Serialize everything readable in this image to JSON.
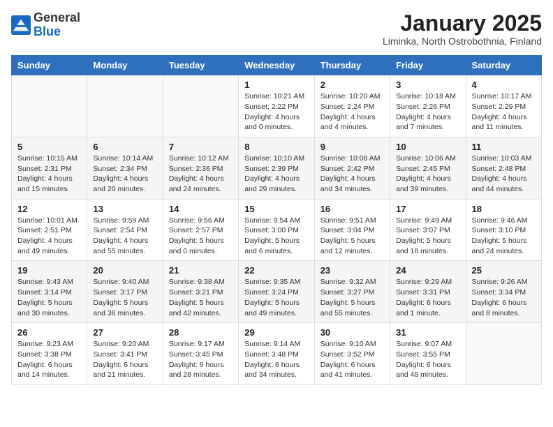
{
  "logo": {
    "general": "General",
    "blue": "Blue"
  },
  "header": {
    "month_title": "January 2025",
    "subtitle": "Liminka, North Ostrobothnia, Finland"
  },
  "days_of_week": [
    "Sunday",
    "Monday",
    "Tuesday",
    "Wednesday",
    "Thursday",
    "Friday",
    "Saturday"
  ],
  "weeks": [
    [
      {
        "day": "",
        "info": ""
      },
      {
        "day": "",
        "info": ""
      },
      {
        "day": "",
        "info": ""
      },
      {
        "day": "1",
        "info": "Sunrise: 10:21 AM\nSunset: 2:22 PM\nDaylight: 4 hours\nand 0 minutes."
      },
      {
        "day": "2",
        "info": "Sunrise: 10:20 AM\nSunset: 2:24 PM\nDaylight: 4 hours\nand 4 minutes."
      },
      {
        "day": "3",
        "info": "Sunrise: 10:18 AM\nSunset: 2:26 PM\nDaylight: 4 hours\nand 7 minutes."
      },
      {
        "day": "4",
        "info": "Sunrise: 10:17 AM\nSunset: 2:29 PM\nDaylight: 4 hours\nand 11 minutes."
      }
    ],
    [
      {
        "day": "5",
        "info": "Sunrise: 10:15 AM\nSunset: 2:31 PM\nDaylight: 4 hours\nand 15 minutes."
      },
      {
        "day": "6",
        "info": "Sunrise: 10:14 AM\nSunset: 2:34 PM\nDaylight: 4 hours\nand 20 minutes."
      },
      {
        "day": "7",
        "info": "Sunrise: 10:12 AM\nSunset: 2:36 PM\nDaylight: 4 hours\nand 24 minutes."
      },
      {
        "day": "8",
        "info": "Sunrise: 10:10 AM\nSunset: 2:39 PM\nDaylight: 4 hours\nand 29 minutes."
      },
      {
        "day": "9",
        "info": "Sunrise: 10:08 AM\nSunset: 2:42 PM\nDaylight: 4 hours\nand 34 minutes."
      },
      {
        "day": "10",
        "info": "Sunrise: 10:06 AM\nSunset: 2:45 PM\nDaylight: 4 hours\nand 39 minutes."
      },
      {
        "day": "11",
        "info": "Sunrise: 10:03 AM\nSunset: 2:48 PM\nDaylight: 4 hours\nand 44 minutes."
      }
    ],
    [
      {
        "day": "12",
        "info": "Sunrise: 10:01 AM\nSunset: 2:51 PM\nDaylight: 4 hours\nand 49 minutes."
      },
      {
        "day": "13",
        "info": "Sunrise: 9:59 AM\nSunset: 2:54 PM\nDaylight: 4 hours\nand 55 minutes."
      },
      {
        "day": "14",
        "info": "Sunrise: 9:56 AM\nSunset: 2:57 PM\nDaylight: 5 hours\nand 0 minutes."
      },
      {
        "day": "15",
        "info": "Sunrise: 9:54 AM\nSunset: 3:00 PM\nDaylight: 5 hours\nand 6 minutes."
      },
      {
        "day": "16",
        "info": "Sunrise: 9:51 AM\nSunset: 3:04 PM\nDaylight: 5 hours\nand 12 minutes."
      },
      {
        "day": "17",
        "info": "Sunrise: 9:49 AM\nSunset: 3:07 PM\nDaylight: 5 hours\nand 18 minutes."
      },
      {
        "day": "18",
        "info": "Sunrise: 9:46 AM\nSunset: 3:10 PM\nDaylight: 5 hours\nand 24 minutes."
      }
    ],
    [
      {
        "day": "19",
        "info": "Sunrise: 9:43 AM\nSunset: 3:14 PM\nDaylight: 5 hours\nand 30 minutes."
      },
      {
        "day": "20",
        "info": "Sunrise: 9:40 AM\nSunset: 3:17 PM\nDaylight: 5 hours\nand 36 minutes."
      },
      {
        "day": "21",
        "info": "Sunrise: 9:38 AM\nSunset: 3:21 PM\nDaylight: 5 hours\nand 42 minutes."
      },
      {
        "day": "22",
        "info": "Sunrise: 9:35 AM\nSunset: 3:24 PM\nDaylight: 5 hours\nand 49 minutes."
      },
      {
        "day": "23",
        "info": "Sunrise: 9:32 AM\nSunset: 3:27 PM\nDaylight: 5 hours\nand 55 minutes."
      },
      {
        "day": "24",
        "info": "Sunrise: 9:29 AM\nSunset: 3:31 PM\nDaylight: 6 hours\nand 1 minute."
      },
      {
        "day": "25",
        "info": "Sunrise: 9:26 AM\nSunset: 3:34 PM\nDaylight: 6 hours\nand 8 minutes."
      }
    ],
    [
      {
        "day": "26",
        "info": "Sunrise: 9:23 AM\nSunset: 3:38 PM\nDaylight: 6 hours\nand 14 minutes."
      },
      {
        "day": "27",
        "info": "Sunrise: 9:20 AM\nSunset: 3:41 PM\nDaylight: 6 hours\nand 21 minutes."
      },
      {
        "day": "28",
        "info": "Sunrise: 9:17 AM\nSunset: 3:45 PM\nDaylight: 6 hours\nand 28 minutes."
      },
      {
        "day": "29",
        "info": "Sunrise: 9:14 AM\nSunset: 3:48 PM\nDaylight: 6 hours\nand 34 minutes."
      },
      {
        "day": "30",
        "info": "Sunrise: 9:10 AM\nSunset: 3:52 PM\nDaylight: 6 hours\nand 41 minutes."
      },
      {
        "day": "31",
        "info": "Sunrise: 9:07 AM\nSunset: 3:55 PM\nDaylight: 6 hours\nand 48 minutes."
      },
      {
        "day": "",
        "info": ""
      }
    ]
  ]
}
